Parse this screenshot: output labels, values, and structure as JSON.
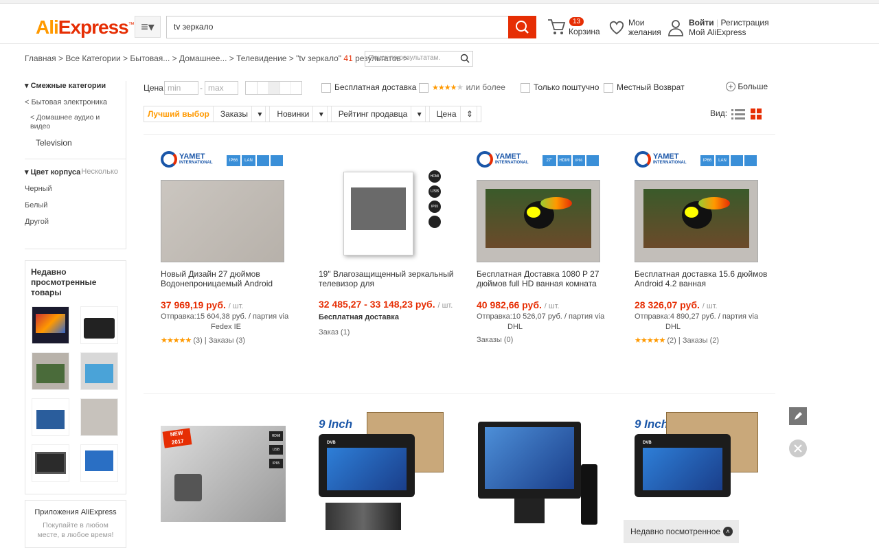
{
  "header": {
    "logo_a": "Ali",
    "logo_b": "Express",
    "search_value": "tv зеркало",
    "cart_count": "13",
    "cart_label": "Корзина",
    "wish_label_1": "Мои",
    "wish_label_2": "желания",
    "login": "Войти",
    "register": "Регистрация",
    "my_ali": "Мой AliExpress"
  },
  "breadcrumb": {
    "path": "Главная > Все Категории > Бытовая... > Домашнее... > Телевидение > \"tv зеркало\"",
    "count": "41",
    "results": "результатов >",
    "sub_search_placeholder": "Поиск по результатам."
  },
  "sidebar": {
    "related_title": "Смежные категории",
    "cat1": "< Бытовая электроника",
    "cat2": "< Домашнее аудио и видео",
    "cat3": "Television",
    "color_title": "Цвет корпуса",
    "color_multi": "Несколько",
    "colors": [
      "Черный",
      "Белый",
      "Другой"
    ],
    "recent_title": "Недавно просмотренные товары",
    "apps_title": "Приложения AliExpress",
    "apps_sub": "Покупайте в любом месте, в любое время!"
  },
  "filters": {
    "price_label": "Цена:",
    "min": "min",
    "max": "max",
    "free_ship": "Бесплатная доставка",
    "rating_more": "или более",
    "by_post": "Только поштучно",
    "local_return": "Местный Возврат",
    "more": "Больше"
  },
  "sort": {
    "best": "Лучший выбор",
    "orders": "Заказы",
    "new": "Новинки",
    "seller_rating": "Рейтинг продавца",
    "price": "Цена",
    "view": "Вид:"
  },
  "products": [
    {
      "title": "Новый Дизайн 27 дюймов Водонепроницаемый Android",
      "price": "37 969,19 руб.",
      "unit": "/ шт.",
      "ship": "Отправка:15 604,38 руб. / партия via",
      "carrier": "Fedex IE",
      "reviews": "(3)",
      "orders": "Заказы (3)"
    },
    {
      "title": "19\" Влагозащищенный зеркальный телевизор для",
      "price": "32 485,27 - 33 148,23 руб.",
      "unit": "/ шт.",
      "ship": "Бесплатная доставка",
      "orders": "Заказ (1)"
    },
    {
      "title": "Бесплатная Доставка 1080 P 27 дюймов full HD ванная комната",
      "price": "40 982,66 руб.",
      "unit": "/ шт.",
      "ship": "Отправка:10 526,07 руб. / партия via",
      "carrier": "DHL",
      "orders": "Заказы (0)"
    },
    {
      "title": "Бесплатная доставка 15.6 дюймов Android 4.2 ванная",
      "price": "28 326,07 руб.",
      "unit": "/ шт.",
      "ship": "Отправка:4 890,27 руб. / партия via",
      "carrier": "DHL",
      "reviews": "(2)",
      "orders": "Заказы (2)"
    }
  ],
  "badges": {
    "yamet": "YAMET",
    "intl": "INTERNATIONAL",
    "ip66": "IP66",
    "lan": "LAN",
    "hdmi": "HDMI",
    "usb": "USB",
    "ip65": "IP65",
    "size27": "27\"",
    "inch9": "9 Inch",
    "new": "NEW",
    "year": "2017",
    "dvb": "DVB"
  },
  "recent_bar": "Недавно посмотренное"
}
